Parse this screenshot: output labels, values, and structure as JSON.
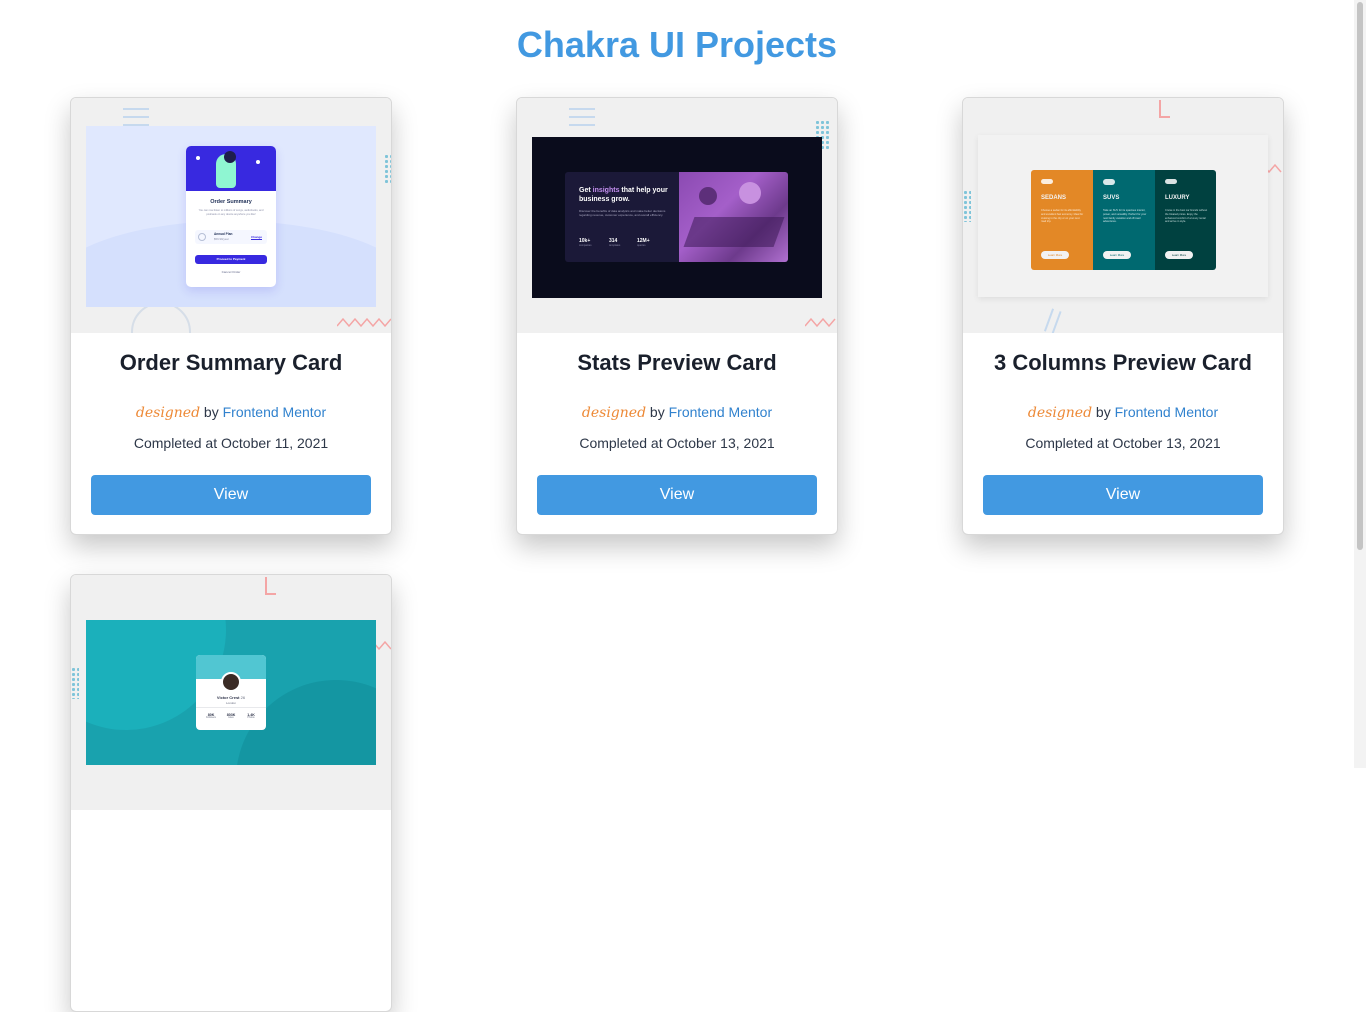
{
  "page": {
    "title": "Chakra UI Projects"
  },
  "projects": [
    {
      "title": "Order Summary Card",
      "designed_label": "designed",
      "by_label": "by",
      "author_link": "Frontend Mentor",
      "completed": "Completed at October 11, 2021",
      "button_label": "View",
      "preview": {
        "heading": "Order Summary",
        "body": "You can now listen to millions of songs, audiobooks, and podcasts on any device anywhere you like!",
        "plan_name": "Annual Plan",
        "plan_price": "$59.99/year",
        "change_label": "Change",
        "pay_label": "Proceed to Payment",
        "cancel_label": "Cancel Order"
      }
    },
    {
      "title": "Stats Preview Card",
      "designed_label": "designed",
      "by_label": "by",
      "author_link": "Frontend Mentor",
      "completed": "Completed at October 13, 2021",
      "button_label": "View",
      "preview": {
        "heading_pre": "Get ",
        "heading_accent": "insights",
        "heading_post": " that help your business grow.",
        "body": "Discover the benefits of data analytics and make better decisions regarding revenue, customer experience, and overall efficiency.",
        "stats": [
          {
            "value": "10k+",
            "label": "companies"
          },
          {
            "value": "314",
            "label": "templates"
          },
          {
            "value": "12M+",
            "label": "queries"
          }
        ]
      }
    },
    {
      "title": "3 Columns Preview Card",
      "designed_label": "designed",
      "by_label": "by",
      "author_link": "Frontend Mentor",
      "completed": "Completed at October 13, 2021",
      "button_label": "View",
      "preview": {
        "columns": [
          {
            "heading": "SEDANS",
            "color": "#e38826",
            "body": "Choose a sedan for its affordability and excellent fuel economy. Ideal for cruising in the city or on your next road trip.",
            "button": "Learn More"
          },
          {
            "heading": "SUVS",
            "color": "#006970",
            "body": "Take an SUV for its spacious interior, power, and versatility. Perfect for your next family vacation and off-road adventures.",
            "button": "Learn More"
          },
          {
            "heading": "LUXURY",
            "color": "#004140",
            "body": "Cruise in the best car brands without the bloated prices. Enjoy the enhanced comfort of a luxury rental and arrive in style.",
            "button": "Learn More"
          }
        ]
      }
    },
    {
      "preview": {
        "name": "Victor Crest",
        "age": "26",
        "city": "London",
        "stats": [
          {
            "value": "80K",
            "label": "Followers"
          },
          {
            "value": "803K",
            "label": "Likes"
          },
          {
            "value": "1.4K",
            "label": "Photos"
          }
        ]
      }
    }
  ]
}
